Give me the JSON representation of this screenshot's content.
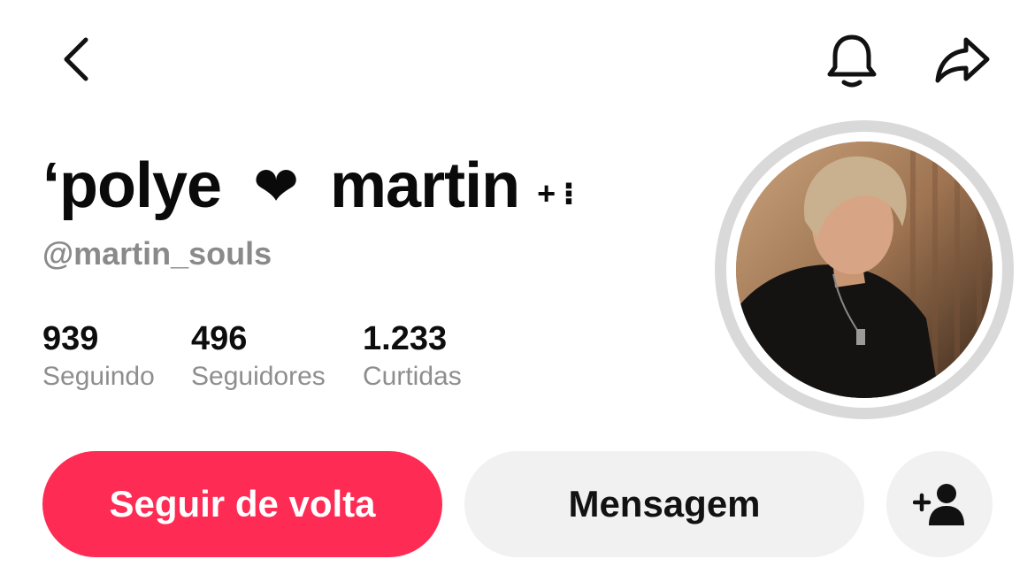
{
  "header": {
    "back_icon": "chevron-left-icon",
    "notification_icon": "bell-icon",
    "share_icon": "share-arrow-icon"
  },
  "profile": {
    "display_name_part1": "‘polye",
    "heart": "❤",
    "display_name_part2": "martin",
    "decoration": "+ ⁝",
    "username": "@martin_souls"
  },
  "stats": [
    {
      "value": "939",
      "label": "Seguindo"
    },
    {
      "value": "496",
      "label": "Seguidores"
    },
    {
      "value": "1.233",
      "label": "Curtidas"
    }
  ],
  "actions": {
    "follow_back_label": "Seguir de volta",
    "message_label": "Mensagem",
    "add_friend_icon": "add-user-icon"
  },
  "colors": {
    "accent": "#fe2c55",
    "secondary_button": "#f1f1f2",
    "muted_text": "#8a8a8a"
  }
}
